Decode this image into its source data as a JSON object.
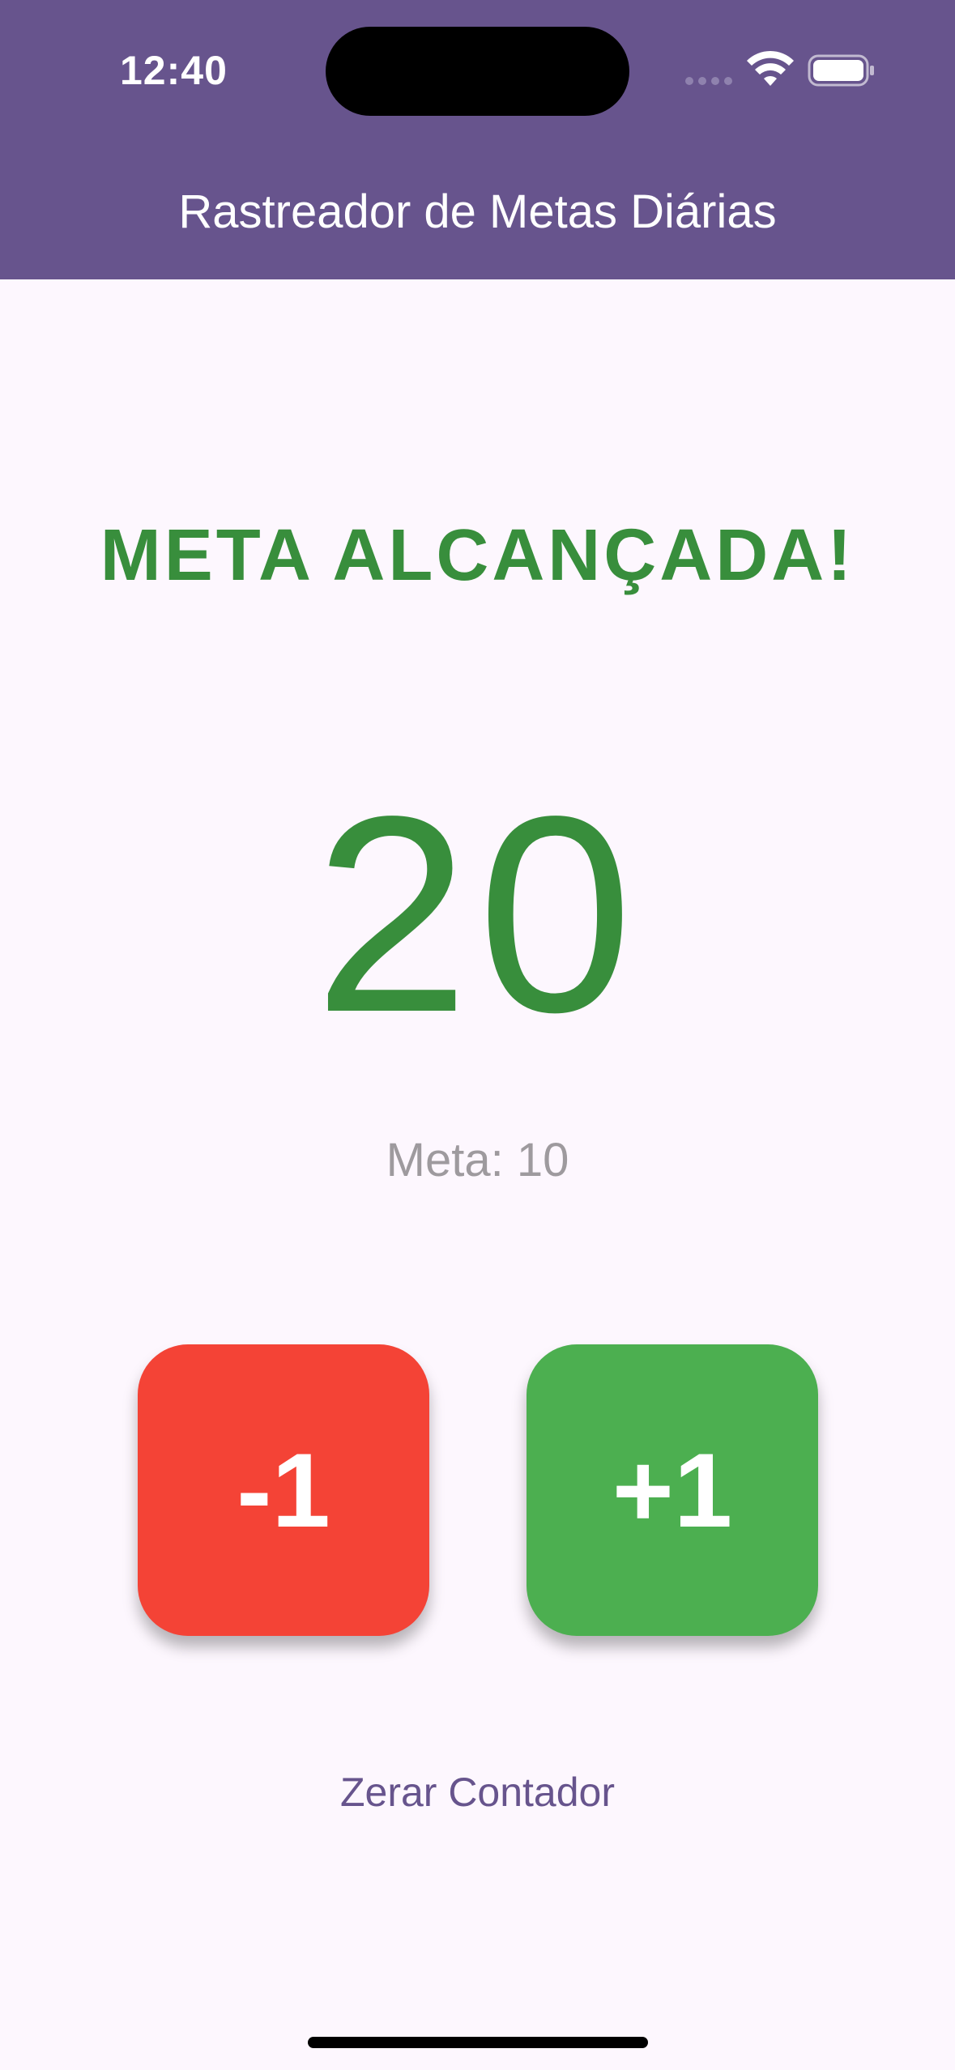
{
  "status_bar": {
    "time": "12:40",
    "icons": [
      "signal-dots-icon",
      "wifi-icon",
      "battery-icon"
    ]
  },
  "app_bar": {
    "title": "Rastreador de Metas Diárias",
    "color": "#67548d"
  },
  "main": {
    "goal_status": "META ALCANÇADA!",
    "counter": "20",
    "goal_label": "Meta: 10",
    "status_color": "#388e3c"
  },
  "buttons": {
    "decrement_label": "-1",
    "increment_label": "+1",
    "decrement_color": "#f44336",
    "increment_color": "#4caf50"
  },
  "reset": {
    "label": "Zerar Contador"
  }
}
